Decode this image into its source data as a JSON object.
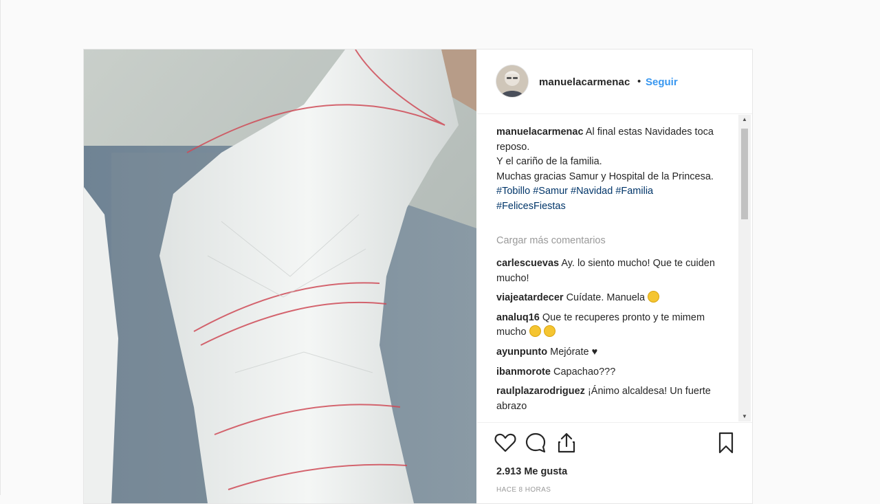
{
  "post": {
    "author": {
      "username": "manuelacarmenac",
      "separator": "•",
      "follow_label": "Seguir"
    },
    "caption": {
      "username": "manuelacarmenac",
      "line1": "Al final estas Navidades toca reposo.",
      "line2": "Y el cariño de la familia.",
      "line3": "Muchas gracias Samur y Hospital de la Princesa.",
      "hashtags": [
        "#Tobillo",
        "#Samur",
        "#Navidad",
        "#Familia",
        "#FelicesFiestas"
      ]
    },
    "load_more_label": "Cargar más comentarios",
    "comments": [
      {
        "user": "carlescuevas",
        "text": "Ay. lo siento mucho! Que te cuiden mucho!",
        "emoji": ""
      },
      {
        "user": "viajeatardecer",
        "text": "Cuídate. Manuela",
        "emoji": "smiling-face"
      },
      {
        "user": "analuq16",
        "text": "Que te recuperes pronto y te mimem mucho",
        "emoji": "kissing-faces"
      },
      {
        "user": "ayunpunto",
        "text": "Mejórate ♥",
        "emoji": ""
      },
      {
        "user": "ibanmorote",
        "text": "Capachao???",
        "emoji": ""
      },
      {
        "user": "raulplazarodriguez",
        "text": "¡Ánimo alcaldesa! Un fuerte abrazo",
        "emoji": ""
      }
    ],
    "likes_label": "2.913 Me gusta",
    "timestamp": "HACE 8 HORAS",
    "icons": {
      "like": "heart-icon",
      "comment": "comment-bubble-icon",
      "share": "share-icon",
      "save": "bookmark-icon",
      "scroll_up": "▲",
      "scroll_down": "▼"
    },
    "colors": {
      "link_blue": "#3897f0",
      "hashtag": "#003569",
      "muted": "#999999"
    }
  }
}
